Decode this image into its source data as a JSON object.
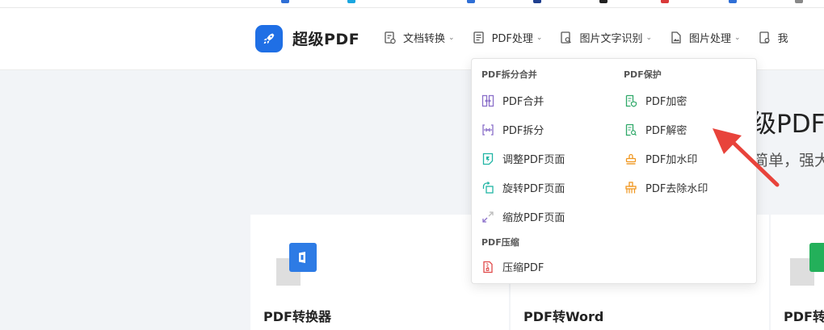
{
  "brand": {
    "name": "超级PDF"
  },
  "nav": {
    "items": [
      {
        "label": "文档转换"
      },
      {
        "label": "PDF处理"
      },
      {
        "label": "图片文字识别"
      },
      {
        "label": "图片处理"
      },
      {
        "label": "我"
      }
    ],
    "caret": "⌄"
  },
  "dropdown": {
    "sections": [
      {
        "title": "PDF拆分合并"
      },
      {
        "title": "PDF保护"
      },
      {
        "title": "PDF压缩"
      }
    ],
    "split_merge": [
      {
        "label": "PDF合并",
        "icon": "merge-icon"
      },
      {
        "label": "PDF拆分",
        "icon": "split-icon"
      },
      {
        "label": "调整PDF页面",
        "icon": "adjust-page-icon"
      },
      {
        "label": "旋转PDF页面",
        "icon": "rotate-page-icon"
      },
      {
        "label": "缩放PDF页面",
        "icon": "scale-page-icon"
      }
    ],
    "protect": [
      {
        "label": "PDF加密",
        "icon": "encrypt-icon"
      },
      {
        "label": "PDF解密",
        "icon": "decrypt-icon"
      },
      {
        "label": "PDF加水印",
        "icon": "watermark-stamp-icon"
      },
      {
        "label": "PDF去除水印",
        "icon": "remove-watermark-icon"
      }
    ],
    "compress": [
      {
        "label": "压缩PDF",
        "icon": "zip-file-icon"
      }
    ]
  },
  "hero": {
    "title": "级PDF",
    "subtitle": "简单，强大"
  },
  "cards": [
    {
      "title": "PDF转换器"
    },
    {
      "title": "PDF转Word"
    },
    {
      "title": "PDF转"
    }
  ],
  "colors": {
    "brand_blue": "#1f6fe5",
    "purple": "#8a6fc9",
    "teal": "#21b5a5",
    "green": "#2ea868",
    "orange": "#f0961e",
    "red": "#e04a4a",
    "arrow_red": "#e8433b"
  }
}
